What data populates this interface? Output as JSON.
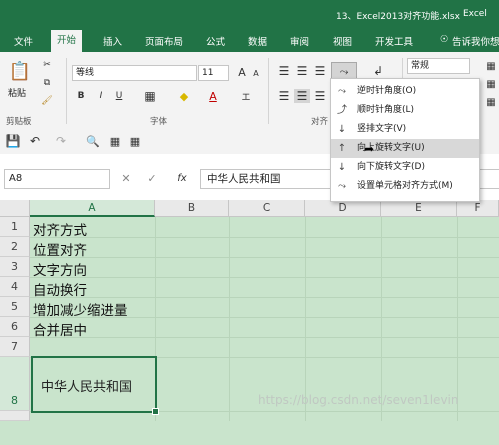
{
  "window": {
    "title": "13、Excel2013对齐功能.xlsx",
    "app_name": "Excel"
  },
  "tabs": [
    {
      "label": "文件",
      "active": false
    },
    {
      "label": "开始",
      "active": true
    },
    {
      "label": "插入",
      "active": false
    },
    {
      "label": "页面布局",
      "active": false
    },
    {
      "label": "公式",
      "active": false
    },
    {
      "label": "数据",
      "active": false
    },
    {
      "label": "审阅",
      "active": false
    },
    {
      "label": "视图",
      "active": false
    },
    {
      "label": "开发工具",
      "active": false
    },
    {
      "label": "告诉我你想",
      "active": false
    }
  ],
  "ribbon": {
    "paste_label": "粘贴",
    "clipboard_group": "剪贴板",
    "font_name": "等线",
    "font_size": "11",
    "font_group": "字体",
    "align_group": "对齐",
    "number_format": "常规",
    "grow_font": "A",
    "shrink_font": "A",
    "bold": "B",
    "italic": "I",
    "underline": "U",
    "font_color_glyph": "A"
  },
  "formula_bar": {
    "name_box": "A8",
    "fx": "fx",
    "content": "中华人民共和国"
  },
  "columns": [
    "A",
    "B",
    "C",
    "D",
    "E",
    "F"
  ],
  "rows": [
    {
      "num": "1",
      "a": "对齐方式"
    },
    {
      "num": "2",
      "a": "位置对齐"
    },
    {
      "num": "3",
      "a": "文字方向"
    },
    {
      "num": "4",
      "a": "自动换行"
    },
    {
      "num": "5",
      "a": "增加减少缩进量"
    },
    {
      "num": "6",
      "a": "合并居中"
    },
    {
      "num": "7",
      "a": ""
    },
    {
      "num": "8",
      "a": "中华人民共和国"
    }
  ],
  "orientation_menu": {
    "items": [
      {
        "label": "逆时针角度(O)",
        "icon": "rotate-ccw-icon",
        "highlighted": false
      },
      {
        "label": "顺时针角度(L)",
        "icon": "rotate-cw-icon",
        "highlighted": false
      },
      {
        "label": "竖排文字(V)",
        "icon": "vertical-text-icon",
        "highlighted": false
      },
      {
        "label": "向上旋转文字(U)",
        "icon": "rotate-up-icon",
        "highlighted": true
      },
      {
        "label": "向下旋转文字(D)",
        "icon": "rotate-down-icon",
        "highlighted": false
      },
      {
        "label": "设置单元格对齐方式(M)",
        "icon": "format-alignment-icon",
        "highlighted": false
      }
    ]
  },
  "watermark": "https://blog.csdn.net/seven1levin",
  "colors": {
    "accent": "#217346",
    "grid_bg": "#c9e4cc",
    "menu_highlight": "#d8d8d8"
  }
}
